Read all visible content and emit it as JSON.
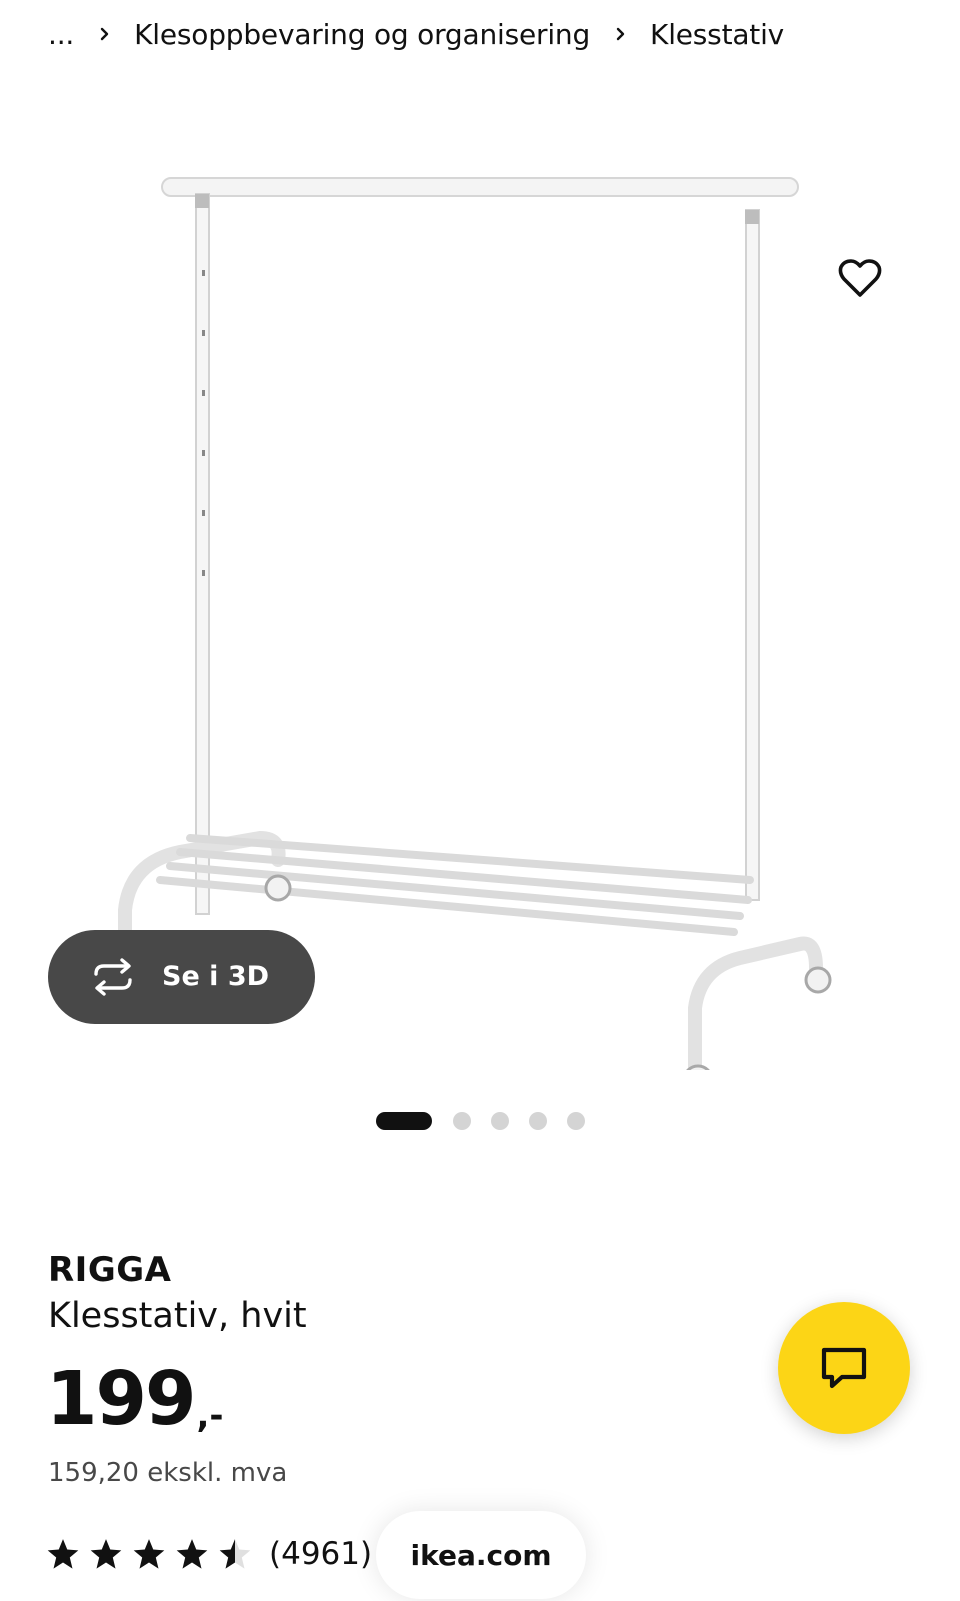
{
  "breadcrumb": {
    "ellipsis": "...",
    "items": [
      "Klesoppbevaring og organisering",
      "Klesstativ"
    ]
  },
  "gallery": {
    "view_3d_label": "Se i 3D",
    "dots_total": 5,
    "active_dot_index": 0
  },
  "product": {
    "name": "RIGGA",
    "description": "Klesstativ, hvit",
    "price_amount": "199",
    "price_suffix": ",-",
    "price_ex_vat": "159,20 ekskl. mva",
    "rating_value": 4.5,
    "rating_max": 5,
    "rating_count": "(4961)"
  },
  "browser": {
    "url": "ikea.com"
  },
  "icons": {
    "favorite": "heart-icon",
    "view_3d": "rotate-3d-icon",
    "chat": "chat-bubble-icon",
    "separator": "chevron-right-icon"
  },
  "colors": {
    "chat_button": "#fcd516",
    "view_3d_button": "#484848",
    "text": "#111111",
    "dot_inactive": "#d4d4d4"
  }
}
